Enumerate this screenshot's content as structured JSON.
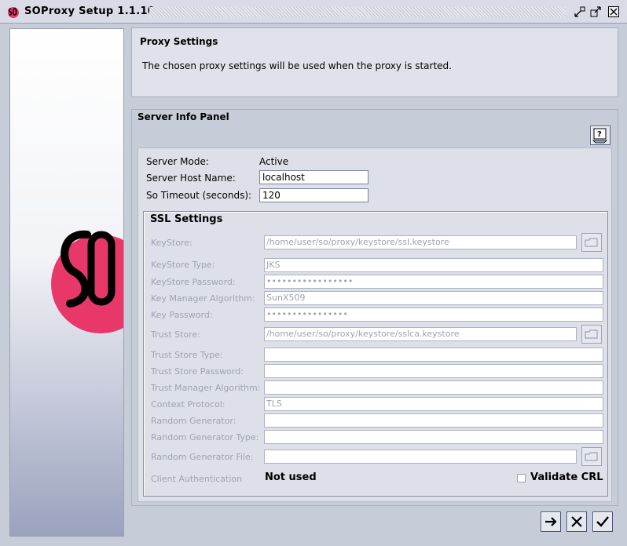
{
  "window": {
    "title": "SOProxy Setup 1.1.10",
    "app_icon": "so-logo-icon",
    "controls": [
      "minimize-icon",
      "maximize-icon",
      "close-icon"
    ]
  },
  "header": {
    "title": "Proxy Settings",
    "description": "The chosen proxy settings will be used when the proxy is started."
  },
  "server_info": {
    "title": "Server Info Panel",
    "help_icon": "help-icon",
    "mode_label": "Server Mode:",
    "mode_value": "Active",
    "host_label": "Server Host Name:",
    "host_value": "localhost",
    "timeout_label": "So Timeout (seconds):",
    "timeout_value": "120"
  },
  "ssl": {
    "title": "SSL Settings",
    "keystore": {
      "label": "KeyStore:",
      "value": "/home/user/so/proxy/keystore/ssl.keystore"
    },
    "keystore_type": {
      "label": "KeyStore Type:",
      "value": "JKS"
    },
    "keystore_password": {
      "label": "KeyStore Password:",
      "value": "•••••••••••••••••"
    },
    "key_manager_algorithm": {
      "label": "Key Manager Algorithm:",
      "value": "SunX509"
    },
    "key_password": {
      "label": "Key Password:",
      "value": "••••••••••••••••"
    },
    "trust_store": {
      "label": "Trust Store:",
      "value": "/home/user/so/proxy/keystore/sslca.keystore"
    },
    "trust_store_type": {
      "label": "Trust Store Type:",
      "value": ""
    },
    "trust_store_password": {
      "label": "Trust Store Password:",
      "value": ""
    },
    "trust_manager_algorithm": {
      "label": "Trust Manager Algorithm:",
      "value": ""
    },
    "context_protocol": {
      "label": "Context Protocol:",
      "value": "TLS"
    },
    "random_generator": {
      "label": "Random Generator:",
      "value": ""
    },
    "random_generator_type": {
      "label": "Random Generator Type:",
      "value": ""
    },
    "random_generator_file": {
      "label": "Random Generator File:",
      "value": ""
    },
    "client_auth": {
      "label": "Client Authentication",
      "value": "Not used"
    },
    "validate_crl": {
      "label": "Validate CRL",
      "checked": false
    }
  },
  "footer": {
    "buttons": [
      "next-arrow-icon",
      "cancel-x-icon",
      "finish-check-icon"
    ]
  },
  "colors": {
    "logo_red": "#e8386a",
    "background": "#c7ccd9"
  }
}
